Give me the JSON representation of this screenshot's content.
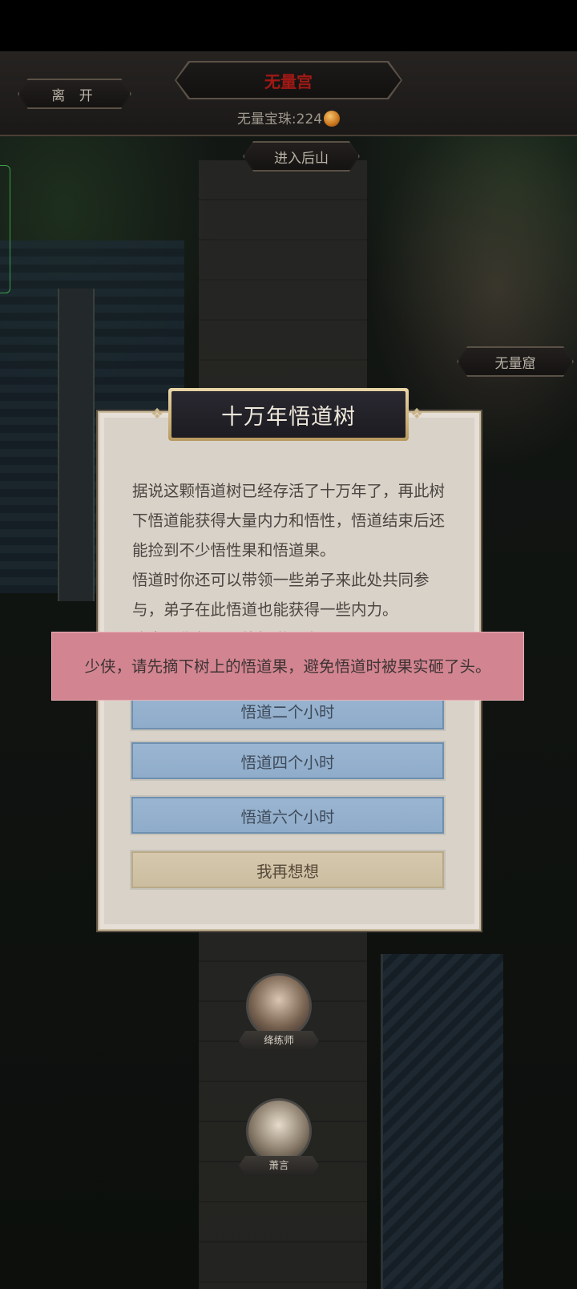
{
  "header": {
    "leave_label": "离 开",
    "location_title": "无量宫",
    "currency_label": "无量宝珠:",
    "currency_value": "224",
    "enter_label": "进入后山"
  },
  "map": {
    "side_location_label": "无量窟"
  },
  "dialog": {
    "title": "十万年悟道树",
    "paragraph1": "据说这颗悟道树已经存活了十万年了，再此树下悟道能获得大量内力和悟性，悟道结束后还能捡到不少悟性果和悟道果。",
    "paragraph2": "悟道时你还可以带领一些弟子来此处共同参与，弟子在此悟道也能获得一些内力。",
    "note_clipped": "注意，你每天只能悟道一次!",
    "options": [
      "悟道二个小时",
      "悟道四个小时",
      "悟道六个小时"
    ],
    "cancel_label": "我再想想"
  },
  "toast": {
    "message": "少侠，请先摘下树上的悟道果，避免悟道时被果实砸了头。"
  },
  "npcs": [
    {
      "name": "绛练师"
    },
    {
      "name": "萧言"
    }
  ]
}
